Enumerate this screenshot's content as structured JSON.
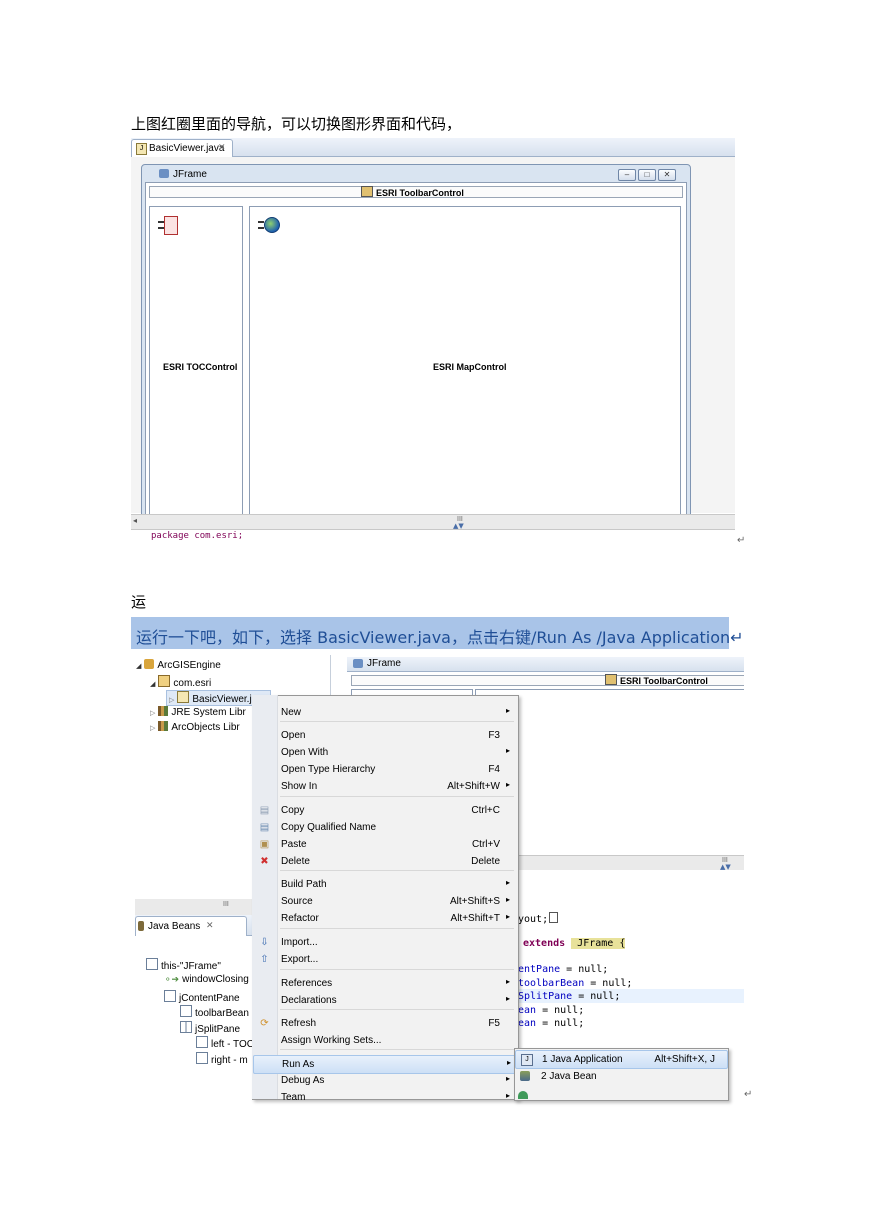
{
  "intro": {
    "paragraph1": "上图红圈里面的导航，可以切换图形界面和代码，",
    "paragraph2": "运",
    "highlight": "运行一下吧，如下，选择 BasicViewer.java，点击右键/Run As /Java Application↵"
  },
  "screenshot1": {
    "tab_label": "BasicViewer.java",
    "frame_title": "JFrame",
    "toolbar_label": "ESRI ToolbarControl",
    "toc_label": "ESRI TOCControl",
    "map_label": "ESRI MapControl",
    "scroll_mark": "III",
    "code_text": "package com.esri;",
    "return_mark": "↵"
  },
  "screenshot2": {
    "tree": [
      {
        "label": "ArcGISEngine"
      },
      {
        "label": "com.esri"
      },
      {
        "label": "BasicViewer.java"
      },
      {
        "label": "JRE System Libr"
      },
      {
        "label": "ArcObjects Libr"
      }
    ],
    "frame_title": "JFrame",
    "toolbar_label": "ESRI ToolbarControl",
    "scroll_mark": "III",
    "beans_tab": "Java Beans",
    "beans_tree": [
      {
        "label": "this-\"JFrame\""
      },
      {
        "label": "windowClosing"
      },
      {
        "label": "jContentPane"
      },
      {
        "label": "toolbarBean"
      },
      {
        "label": "jSplitPane"
      },
      {
        "label": "left - TOC"
      },
      {
        "label": "right - m"
      }
    ],
    "code": {
      "l1": "yout;",
      "l2_kw": "extends",
      "l2_rest": " JFrame {",
      "l3_fld": "entPane",
      "l3_rest": " = null;",
      "l4_fld": "toolbarBean",
      "l4_rest": " = null;",
      "l5_fld": "SplitPane",
      "l5_rest": " = null;",
      "l6_fld": "ean",
      "l6_rest": " = null;",
      "l7_fld": "ean",
      "l7_rest": " = null;"
    },
    "menu": [
      {
        "label": "New",
        "shortcut": "",
        "submenu": true,
        "icon": ""
      },
      {
        "label": "Open",
        "shortcut": "F3",
        "submenu": false,
        "icon": ""
      },
      {
        "label": "Open With",
        "shortcut": "",
        "submenu": true,
        "icon": ""
      },
      {
        "label": "Open Type Hierarchy",
        "shortcut": "F4",
        "submenu": false,
        "icon": ""
      },
      {
        "label": "Show In",
        "shortcut": "Alt+Shift+W",
        "submenu": true,
        "icon": ""
      },
      {
        "label": "Copy",
        "shortcut": "Ctrl+C",
        "submenu": false,
        "icon": "copy-icon"
      },
      {
        "label": "Copy Qualified Name",
        "shortcut": "",
        "submenu": false,
        "icon": "copy-qualified-icon"
      },
      {
        "label": "Paste",
        "shortcut": "Ctrl+V",
        "submenu": false,
        "icon": "paste-icon"
      },
      {
        "label": "Delete",
        "shortcut": "Delete",
        "submenu": false,
        "icon": "delete-icon"
      },
      {
        "label": "Build Path",
        "shortcut": "",
        "submenu": true,
        "icon": ""
      },
      {
        "label": "Source",
        "shortcut": "Alt+Shift+S",
        "submenu": true,
        "icon": ""
      },
      {
        "label": "Refactor",
        "shortcut": "Alt+Shift+T",
        "submenu": true,
        "icon": ""
      },
      {
        "label": "Import...",
        "shortcut": "",
        "submenu": false,
        "icon": "import-icon"
      },
      {
        "label": "Export...",
        "shortcut": "",
        "submenu": false,
        "icon": "export-icon"
      },
      {
        "label": "References",
        "shortcut": "",
        "submenu": true,
        "icon": ""
      },
      {
        "label": "Declarations",
        "shortcut": "",
        "submenu": true,
        "icon": ""
      },
      {
        "label": "Refresh",
        "shortcut": "F5",
        "submenu": false,
        "icon": "refresh-icon"
      },
      {
        "label": "Assign Working Sets...",
        "shortcut": "",
        "submenu": false,
        "icon": ""
      },
      {
        "label": "Run As",
        "shortcut": "",
        "submenu": true,
        "icon": ""
      },
      {
        "label": "Debug As",
        "shortcut": "",
        "submenu": true,
        "icon": ""
      },
      {
        "label": "Team",
        "shortcut": "",
        "submenu": true,
        "icon": ""
      }
    ],
    "submenu": [
      {
        "label": "1 Java Application",
        "shortcut": "Alt+Shift+X, J"
      },
      {
        "label": "2 Java Bean",
        "shortcut": ""
      }
    ],
    "return_mark": "↵"
  },
  "colors": {
    "highlight_bg": "#a9c4e8",
    "highlight_text": "#1f4e96",
    "keyword": "#7f0055",
    "field": "#0000c0"
  }
}
